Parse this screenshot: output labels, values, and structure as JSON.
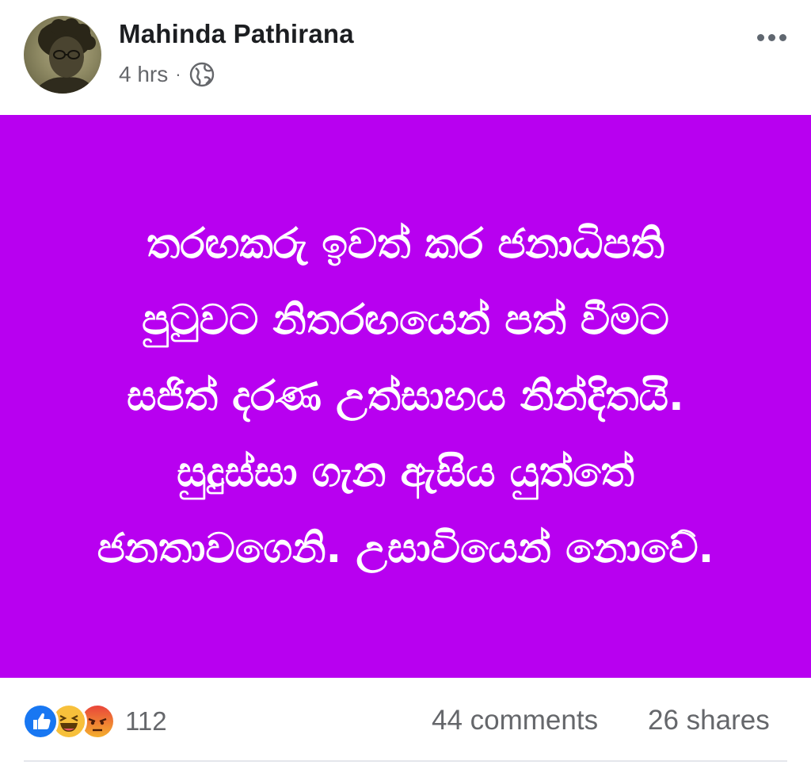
{
  "post": {
    "author_name": "Mahinda Pathirana",
    "timestamp": "4 hrs",
    "separator": "·",
    "privacy_icon": "globe-icon",
    "more_icon": "more-options-icon"
  },
  "banner": {
    "background_color": "#b800f0",
    "text_color": "#ffffff",
    "lines": [
      "තරඟකරු ඉවත් කර ජනාධිපති",
      "පුටුවට නිතරඟයෙන් පත් වීමට",
      "සජිත් දරණ උත්සාහය නින්දිතයි.",
      "සුදුස්සා ගැන ඇසිය යුත්තේ",
      "ජනතාවගෙනි. උසාවියෙන් නොවේ."
    ]
  },
  "footer": {
    "reactions": [
      "like-icon",
      "haha-icon",
      "angry-icon"
    ],
    "reaction_count": "112",
    "comments": "44 comments",
    "shares": "26 shares"
  }
}
